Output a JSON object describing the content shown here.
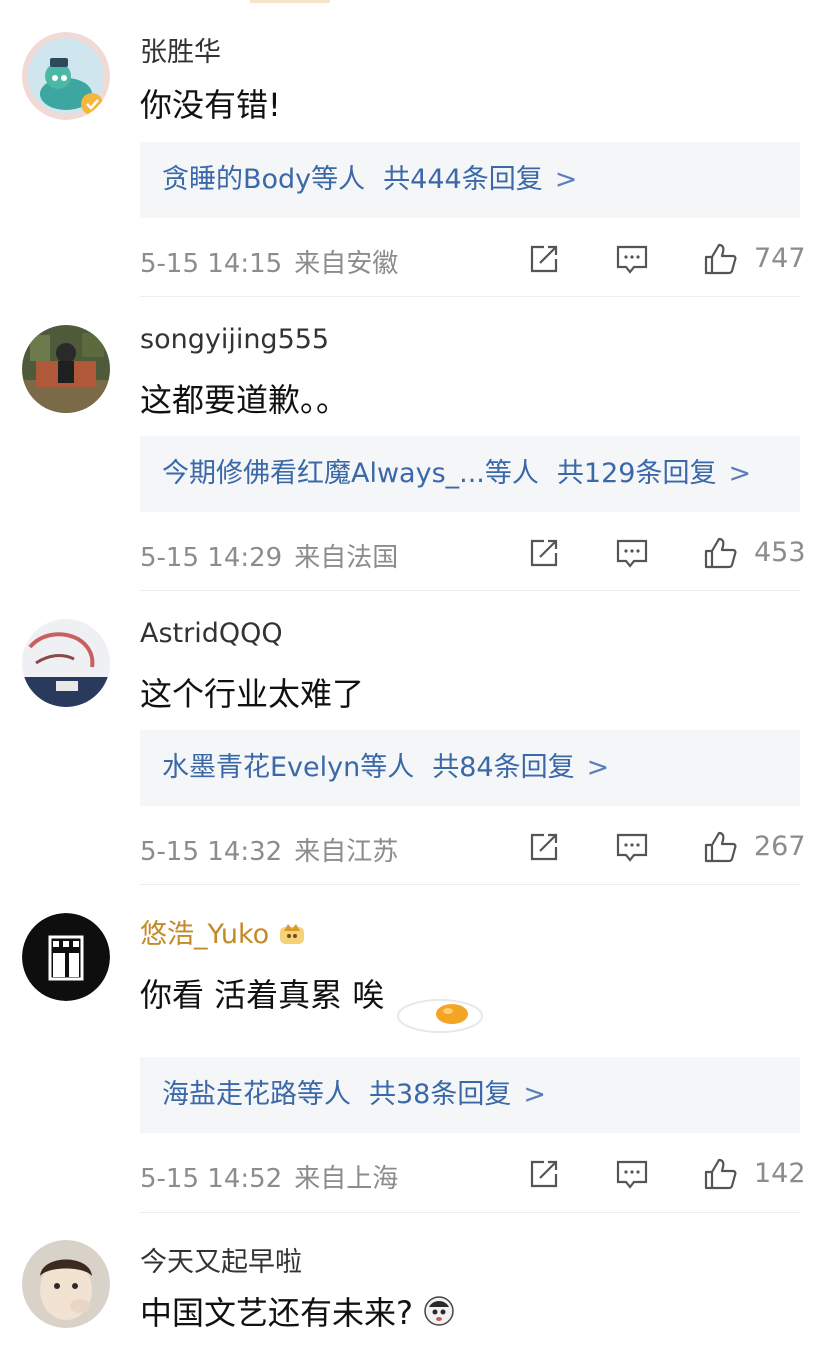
{
  "comments": [
    {
      "username": "张胜华",
      "text": "你没有错!",
      "replies": {
        "names": "贪睡的Body等人",
        "count": "共444条回复",
        "chevron": ">"
      },
      "time": "5-15 14:15",
      "location": "来自安徽",
      "likes": "747"
    },
    {
      "username": "songyijing555",
      "text": "这都要道歉。。",
      "replies": {
        "names": "今期修佛看红魔Always_...等人",
        "count": "共129条回复",
        "chevron": ">"
      },
      "time": "5-15 14:29",
      "location": "来自法国",
      "likes": "453"
    },
    {
      "username": "AstridQQQ",
      "text": "这个行业太难了",
      "replies": {
        "names": "水墨青花Evelyn等人",
        "count": "共84条回复",
        "chevron": ">"
      },
      "time": "5-15 14:32",
      "location": "来自江苏",
      "likes": "267"
    },
    {
      "username": "悠浩_Yuko",
      "text": "你看 活着真累 唉",
      "replies": {
        "names": "海盐走花路等人",
        "count": "共38条回复",
        "chevron": ">"
      },
      "time": "5-15 14:52",
      "location": "来自上海",
      "likes": "142"
    },
    {
      "username": "今天又起早啦",
      "text": "中国文艺还有未来?"
    }
  ],
  "colors": {
    "link": "#3a68a8",
    "meta": "#8c8c8c",
    "vip_name": "#c48a28",
    "reply_bg": "#f5f6f8"
  },
  "icons": [
    "share-icon",
    "comment-icon",
    "like-icon",
    "verified-badge-icon",
    "vip-crown-icon",
    "fried-egg-emoji",
    "sticker-emoji"
  ]
}
